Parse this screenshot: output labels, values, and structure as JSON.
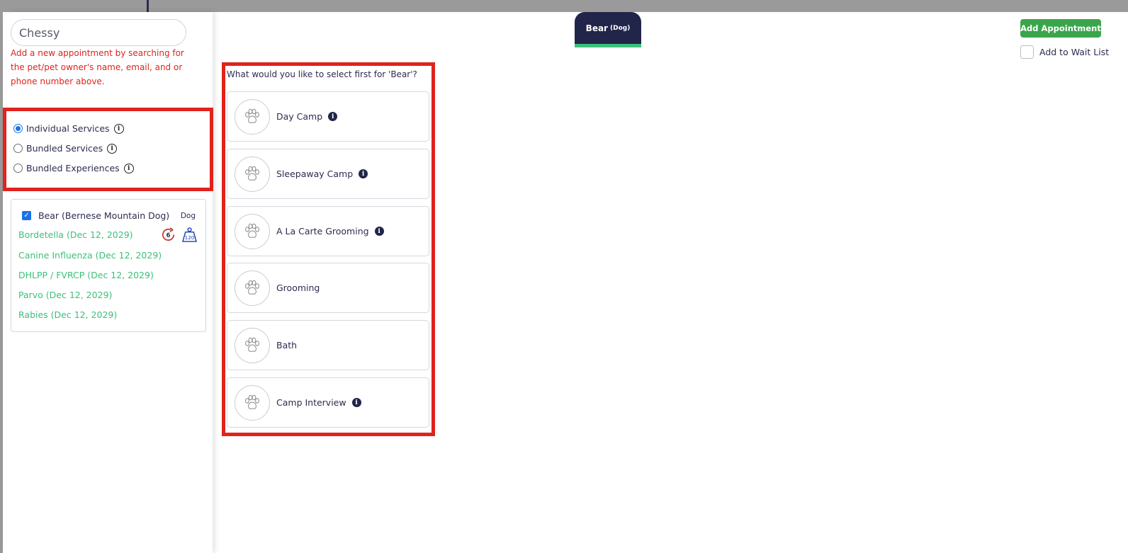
{
  "search": {
    "value": "Chessy"
  },
  "hint_text": "Add a new appointment by searching for the pet/pet owner's name, email, and or phone number above.",
  "service_types": [
    {
      "label": "Individual Services",
      "selected": true
    },
    {
      "label": "Bundled Services",
      "selected": false
    },
    {
      "label": "Bundled Experiences",
      "selected": false
    }
  ],
  "pet": {
    "name": "Bear (Bernese Mountain Dog)",
    "species": "Dog",
    "checked": true,
    "visit_count": "6",
    "weight": "120",
    "vaccinations": [
      "Bordetella (Dec 12, 2029)",
      "Canine Influenza (Dec 12, 2029)",
      "DHLPP / FVRCP (Dec 12, 2029)",
      "Parvo (Dec 12, 2029)",
      "Rabies (Dec 12, 2029)"
    ]
  },
  "pet_tab": {
    "name": "Bear",
    "species": "(Dog)"
  },
  "actions": {
    "add_appointment": "Add Appointment",
    "wait_list": "Add to Wait List"
  },
  "services_question": "What would you like to select first for 'Bear'?",
  "services": [
    {
      "label": "Day Camp",
      "has_info": true
    },
    {
      "label": "Sleepaway Camp",
      "has_info": true
    },
    {
      "label": "A La Carte Grooming",
      "has_info": true
    },
    {
      "label": "Grooming",
      "has_info": false
    },
    {
      "label": "Bath",
      "has_info": false
    },
    {
      "label": "Camp Interview",
      "has_info": true
    }
  ],
  "colors": {
    "accent_red": "#e0231c",
    "vaccine_green": "#3cc07a",
    "navy": "#22254a",
    "button_green": "#3aa54a"
  }
}
